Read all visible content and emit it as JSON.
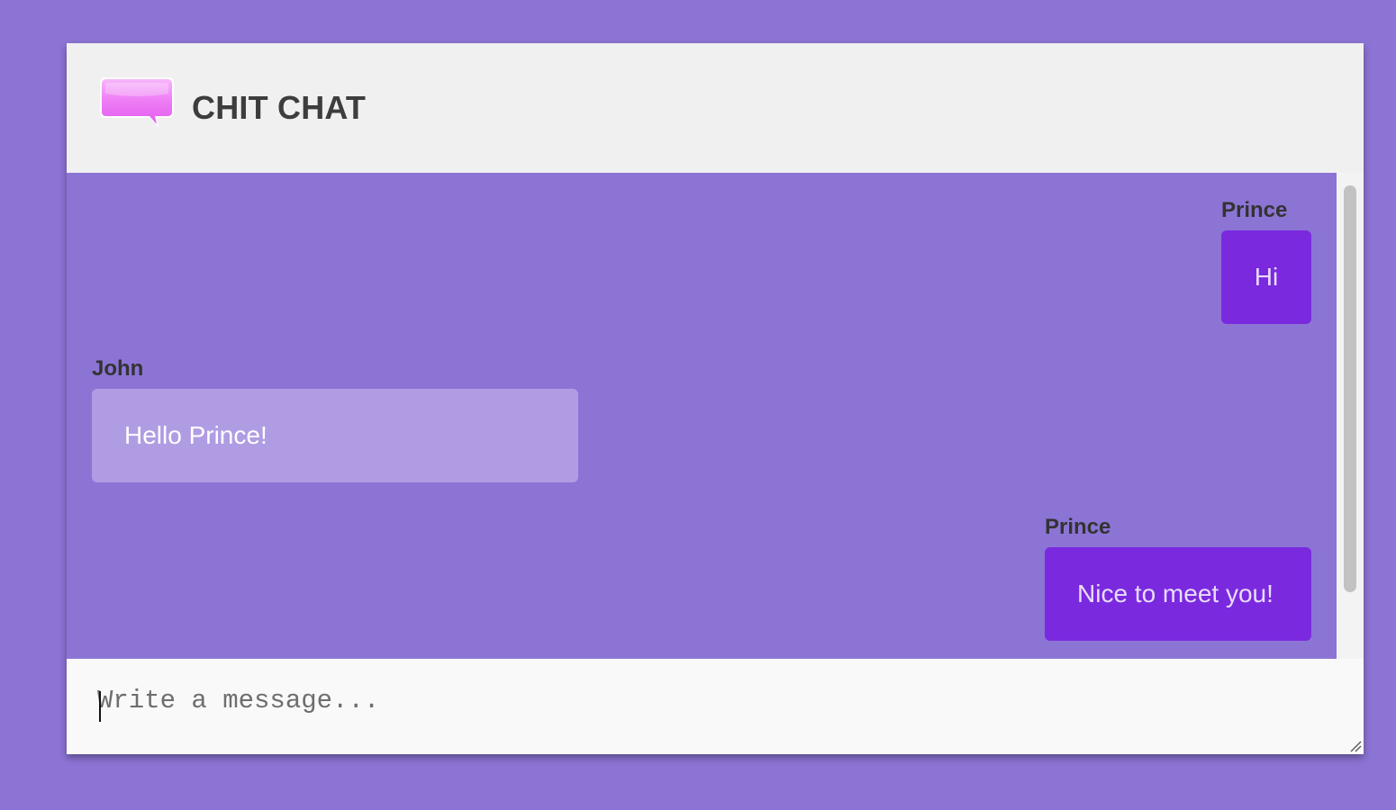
{
  "app": {
    "title": "CHIT CHAT",
    "logo_icon": "speech-bubble-icon"
  },
  "colors": {
    "background": "#8c74d5",
    "header": "#f0f0f0",
    "outgoing_bubble": "#7b29df",
    "incoming_bubble": "#b09ce3",
    "logo": "#ee80f5"
  },
  "messages": [
    {
      "sender": "Prince",
      "text": "Hi",
      "direction": "outgoing"
    },
    {
      "sender": "John",
      "text": "Hello Prince!",
      "direction": "incoming"
    },
    {
      "sender": "Prince",
      "text": "Nice to meet you!",
      "direction": "outgoing"
    }
  ],
  "composer": {
    "placeholder": "Write a message...",
    "value": ""
  }
}
